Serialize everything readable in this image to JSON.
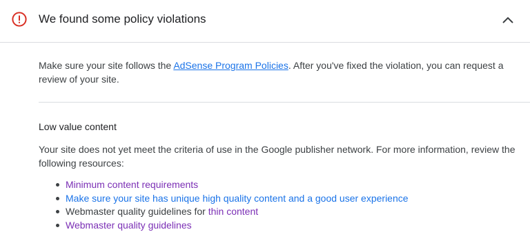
{
  "header": {
    "title": "We found some policy violations",
    "alert_color": "#d93025"
  },
  "intro": {
    "text_before": "Make sure your site follows the ",
    "link_text": "AdSense Program Policies",
    "text_after": ". After you've fixed the violation, you can request a review of your site."
  },
  "section": {
    "title": "Low value content",
    "description": "Your site does not yet meet the criteria of use in the Google publisher network. For more information, review the following resources:"
  },
  "resources": {
    "item1": "Minimum content requirements",
    "item2": "Make sure your site has unique high quality content and a good user experience",
    "item3_prefix": "Webmaster quality guidelines for ",
    "item3_link": "thin content",
    "item4": "Webmaster quality guidelines"
  }
}
